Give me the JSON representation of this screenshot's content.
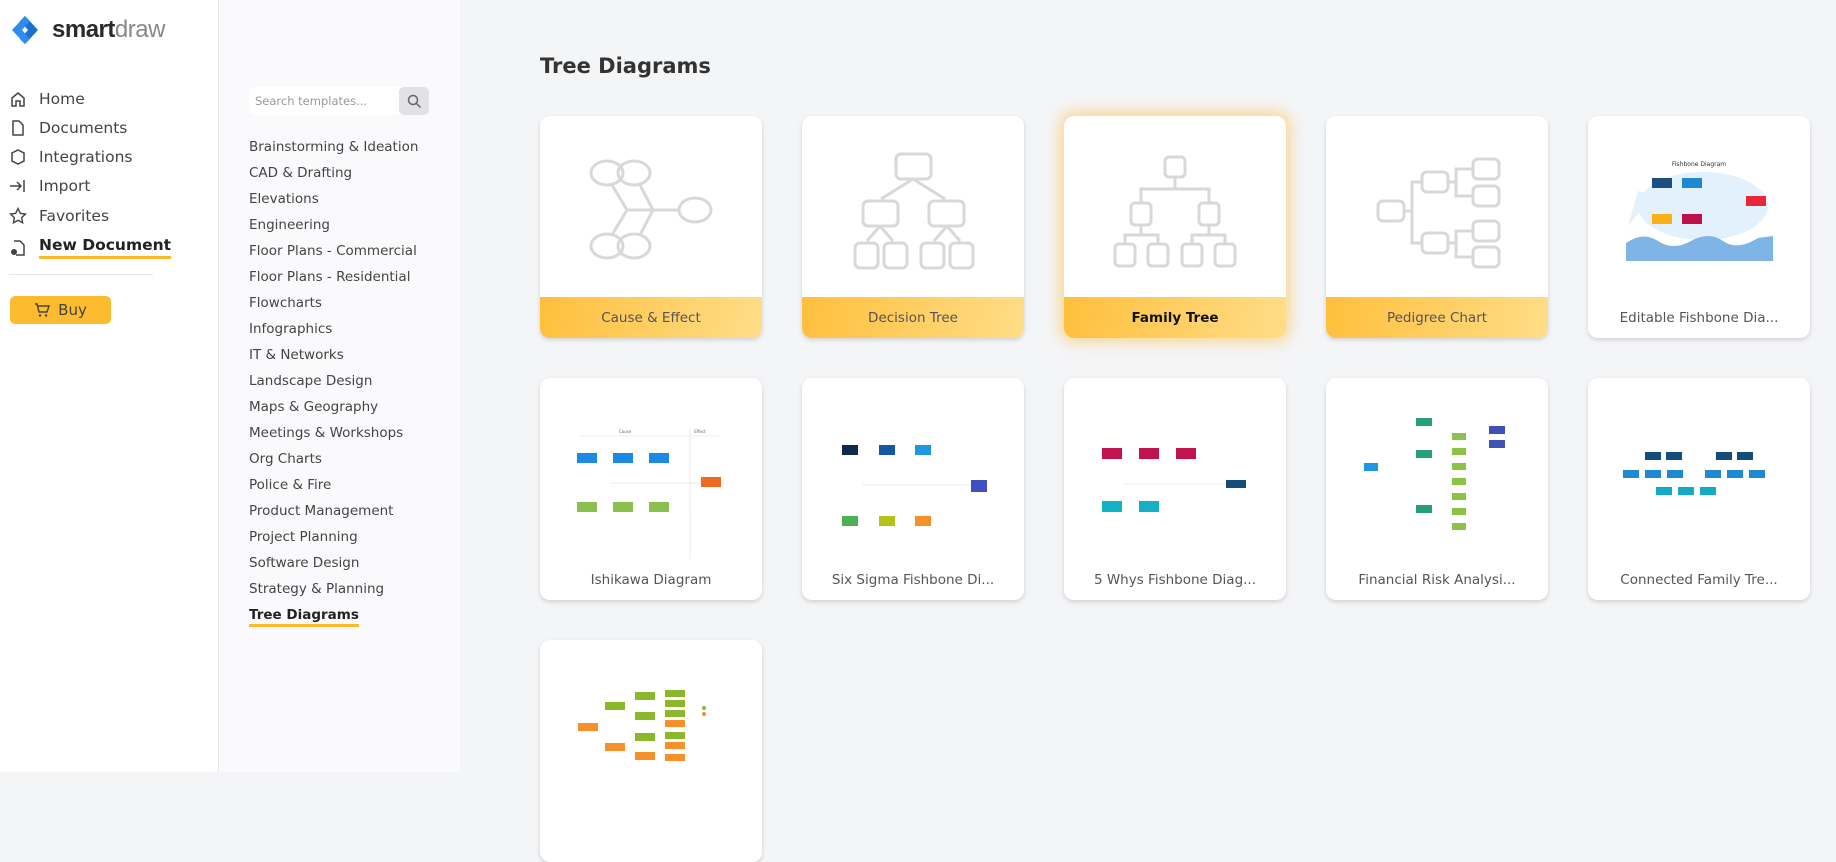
{
  "brand": {
    "name_bold": "smart",
    "name_light": "draw"
  },
  "sidebar": {
    "items": [
      {
        "label": "Home",
        "icon": "home-icon"
      },
      {
        "label": "Documents",
        "icon": "document-icon"
      },
      {
        "label": "Integrations",
        "icon": "puzzle-icon"
      },
      {
        "label": "Import",
        "icon": "import-icon"
      },
      {
        "label": "Favorites",
        "icon": "star-icon"
      },
      {
        "label": "New Document",
        "icon": "new-document-icon",
        "active": true
      }
    ],
    "buy_label": "Buy"
  },
  "search": {
    "placeholder": "Search templates..."
  },
  "categories": [
    "Brainstorming & Ideation",
    "CAD & Drafting",
    "Elevations",
    "Engineering",
    "Floor Plans - Commercial",
    "Floor Plans - Residential",
    "Flowcharts",
    "Infographics",
    "IT & Networks",
    "Landscape Design",
    "Maps & Geography",
    "Meetings & Workshops",
    "Org Charts",
    "Police & Fire",
    "Product Management",
    "Project Planning",
    "Software Design",
    "Strategy & Planning",
    "Tree Diagrams"
  ],
  "active_category": "Tree Diagrams",
  "main": {
    "title": "Tree Diagrams",
    "cards": [
      {
        "label": "Cause & Effect"
      },
      {
        "label": "Decision Tree"
      },
      {
        "label": "Family Tree",
        "highlighted": true
      },
      {
        "label": "Pedigree Chart"
      },
      {
        "label": "Editable Fishbone Dia...",
        "thumb_title": "Fishbone Diagram"
      },
      {
        "label": "Ishikawa Diagram",
        "thumb_cause": "Cause",
        "thumb_effect": "Effect"
      },
      {
        "label": "Six Sigma Fishbone Di..."
      },
      {
        "label": "5 Whys Fishbone Diag..."
      },
      {
        "label": "Financial Risk Analysi..."
      },
      {
        "label": "Connected Family Tre..."
      },
      {
        "label": ""
      }
    ]
  },
  "colors": {
    "accent": "#fdbb30",
    "brand_blue": "#1a73d9"
  }
}
